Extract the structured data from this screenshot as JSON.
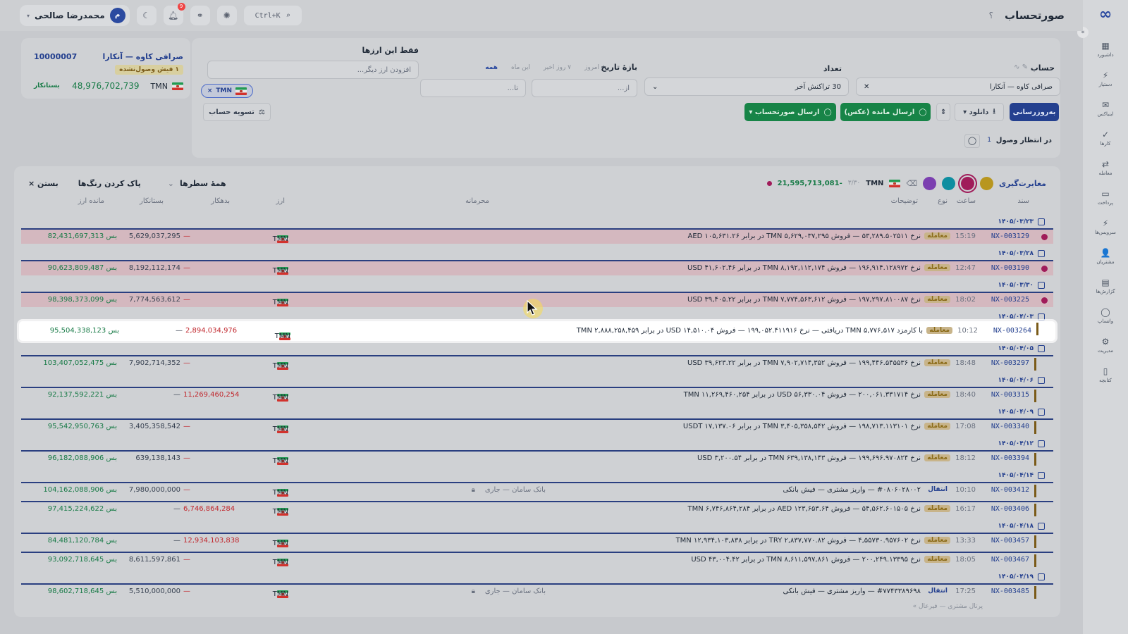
{
  "app": {
    "title": "صورتحساب",
    "help": "؟"
  },
  "topbar": {
    "search": "Ctrl+K",
    "notif_count": "9",
    "user_name": "محمدرضا صالحی",
    "user_initial": "م"
  },
  "sidebar": [
    {
      "icon": "dashboard-icon",
      "glyph": "▦",
      "label": "داشبورد"
    },
    {
      "icon": "assistant-icon",
      "glyph": "⚡",
      "label": "دستیار"
    },
    {
      "icon": "inbox-icon",
      "glyph": "✉",
      "label": "اینباکس"
    },
    {
      "icon": "tasks-icon",
      "glyph": "✓",
      "label": "کارها"
    },
    {
      "icon": "trade-icon",
      "glyph": "⇄",
      "label": "معامله"
    },
    {
      "icon": "payment-icon",
      "glyph": "▭",
      "label": "پرداخت"
    },
    {
      "icon": "services-icon",
      "glyph": "⚡",
      "label": "سرویس‌ها"
    },
    {
      "icon": "customers-icon",
      "glyph": "👤",
      "label": "مشتریان"
    },
    {
      "icon": "reports-icon",
      "glyph": "▤",
      "label": "گزارش‌ها"
    },
    {
      "icon": "whatsapp-icon",
      "glyph": "◯",
      "label": "واتساپ"
    },
    {
      "icon": "management-icon",
      "glyph": "⚙",
      "label": "مدیریت"
    },
    {
      "icon": "library-icon",
      "glyph": "▯",
      "label": "کتابچه"
    }
  ],
  "filters": {
    "account_label": "حساب",
    "account_value": "صرافی کاوه — آنکارا",
    "count_label": "تعداد",
    "count_value": "30 تراکنش آخر",
    "date_label": "بازهٔ تاریخ",
    "date_chips": [
      "امروز",
      "۷ روز اخیر",
      "این ماه",
      "همه"
    ],
    "from_placeholder": "از...",
    "to_placeholder": "تا...",
    "currency_label": "فقط این ارزها",
    "currency_placeholder": "افزودن ارز دیگر...",
    "currency_chip": "TMN",
    "btn_refresh": "به‌روزرسانی",
    "btn_download": "دانلود ▾",
    "btn_send_balance": "ارسال مانده (عکس)",
    "btn_send_statement": "ارسال صورتحساب ▾",
    "btn_settle": "تسویه حساب",
    "pending_label": "در انتظار وصول",
    "pending_count": "1"
  },
  "summary": {
    "name": "صرافی کاوه — آنکارا",
    "code": "10000007",
    "pending": "۱ فیش وصول‌نشده",
    "currency": "TMN",
    "balance": "48,976,702,739",
    "status": "بستانکار"
  },
  "table_toolbar": {
    "title": "مغایرت‌گیری",
    "colors": [
      "#b8961f",
      "#a01c5a",
      "#0e8ea0",
      "#7b3fb0"
    ],
    "currency": "TMN",
    "ratio": "۳/۳۰",
    "amount": "-21,595,713,081",
    "rows_filter": "همهٔ سطرها",
    "clear_colors": "پاک کردن رنگ‌ها",
    "close": "بستن ×"
  },
  "columns": {
    "doc": "سند",
    "time": "ساعت",
    "type": "نوع",
    "desc": "توضیحات",
    "conf": "محرمانه",
    "cur": "ارز",
    "debit": "بدهکار",
    "credit": "بستانکار",
    "balance": "مانده ارز"
  },
  "rows": [
    {
      "date": "۱۴۰۵/۰۳/۲۳",
      "dot": "#a01c5a",
      "doc": "NX-003129",
      "time": "15:19",
      "type": "معامله",
      "desc": "نرخ ۵۳,۲۸۹.۵۰۲۵۱۱ — فروش TMN ۵,۶۲۹,۰۳۷,۲۹۵ در برابر AED ۱۰۵,۶۳۱.۲۶",
      "conf": "",
      "cur": "TMN",
      "debit": "—",
      "credit": "5,629,037,295",
      "balance": "بس 82,431,697,313",
      "tint": true
    },
    {
      "date": "۱۴۰۵/۰۳/۲۸",
      "dot": "#a01c5a",
      "doc": "NX-003190",
      "time": "12:47",
      "type": "معامله",
      "desc": "نرخ ۱۹۶,۹۱۴.۱۲۸۹۷۲ — فروش TMN ۸,۱۹۲,۱۱۲,۱۷۴ در برابر USD ۴۱,۶۰۲.۴۶",
      "conf": "",
      "cur": "TMN",
      "debit": "—",
      "credit": "8,192,112,174",
      "balance": "بس 90,623,809,487",
      "tint": true
    },
    {
      "date": "۱۴۰۵/۰۳/۳۰",
      "dot": "#a01c5a",
      "doc": "NX-003225",
      "time": "18:02",
      "type": "معامله",
      "desc": "نرخ ۱۹۷,۲۹۷.۸۱۰۰۸۷ — فروش TMN ۷,۷۷۴,۵۶۳,۶۱۲ در برابر USD ۳۹,۴۰۵.۲۲",
      "conf": "",
      "cur": "TMN",
      "debit": "—",
      "credit": "7,774,563,612",
      "balance": "بس 98,398,373,099",
      "tint": true
    },
    {
      "date": "۱۴۰۵/۰۴/۰۳",
      "dot": "",
      "doc": "NX-003264",
      "time": "10:12",
      "type": "معامله",
      "desc": "با کارمزد TMN ۵,۷۷۶,۵۱۷ دریافتی — نرخ ۱۹۹,۰۵۲.۴۱۱۹۱۶ — فروش USD ۱۴,۵۱۰.۰۴ در برابر TMN ۲,۸۸۸,۲۵۸,۴۵۹",
      "conf": "",
      "cur": "TMN",
      "debit": "2,894,034,976",
      "credit": "—",
      "balance": "بس 95,504,338,123",
      "highlight": true
    },
    {
      "date": "۱۴۰۵/۰۴/۰۵",
      "dot": "",
      "doc": "NX-003297",
      "time": "18:48",
      "type": "معامله",
      "desc": "نرخ ۱۹۹,۴۴۶.۵۴۵۵۳۶ — فروش TMN ۷,۹۰۲,۷۱۴,۳۵۲ در برابر USD ۳۹,۶۲۳.۲۲",
      "conf": "",
      "cur": "TMN",
      "debit": "—",
      "credit": "7,902,714,352",
      "balance": "بس 103,407,052,475"
    },
    {
      "date": "۱۴۰۵/۰۴/۰۶",
      "dot": "",
      "doc": "NX-003315",
      "time": "18:40",
      "type": "معامله",
      "desc": "نرخ ۲۰۰,۰۶۱.۳۳۱۷۱۴ — فروش USD ۵۶,۳۳۰.۰۴ در برابر TMN ۱۱,۲۶۹,۴۶۰,۲۵۴",
      "conf": "",
      "cur": "TMN",
      "debit": "11,269,460,254",
      "credit": "—",
      "balance": "بس 92,137,592,221"
    },
    {
      "date": "۱۴۰۵/۰۴/۰۹",
      "dot": "",
      "doc": "NX-003340",
      "time": "17:08",
      "type": "معامله",
      "desc": "نرخ ۱۹۸,۷۱۳.۱۱۳۱۰۱ — فروش TMN ۳,۴۰۵,۳۵۸,۵۴۲ در برابر USDT ۱۷,۱۳۷.۰۶",
      "conf": "",
      "cur": "TMN",
      "debit": "—",
      "credit": "3,405,358,542",
      "balance": "بس 95,542,950,763"
    },
    {
      "date": "۱۴۰۵/۰۴/۱۲",
      "dot": "",
      "doc": "NX-003394",
      "time": "18:12",
      "type": "معامله",
      "desc": "نرخ ۱۹۹,۶۹۶.۹۷۰۸۲۴ — فروش TMN ۶۳۹,۱۳۸,۱۴۳ در برابر USD ۳,۲۰۰.۵۴",
      "conf": "",
      "cur": "TMN",
      "debit": "—",
      "credit": "639,138,143",
      "balance": "بس 96,182,088,906"
    },
    {
      "date": "۱۴۰۵/۰۴/۱۴",
      "dot": "",
      "doc": "NX-003412",
      "time": "10:10",
      "type": "انتقال",
      "desc": "#۰۸۰۶۰۲۸۰۰۲ — واریز مشتری — فیش بانکی",
      "conf": "بانک سامان — جاری",
      "cur": "TMN",
      "debit": "—",
      "credit": "7,980,000,000",
      "balance": "بس 104,162,088,906"
    },
    {
      "date": "",
      "dot": "",
      "doc": "NX-003406",
      "time": "16:17",
      "type": "معامله",
      "desc": "نرخ ۵۴,۵۶۲.۶۰۱۵۰۵ — فروش AED ۱۲۳,۶۵۳.۶۴ در برابر TMN ۶,۷۴۶,۸۶۴,۲۸۴",
      "conf": "",
      "cur": "TMN",
      "debit": "6,746,864,284",
      "credit": "—",
      "balance": "بس 97,415,224,622"
    },
    {
      "date": "۱۴۰۵/۰۴/۱۸",
      "dot": "",
      "doc": "NX-003457",
      "time": "13:33",
      "type": "معامله",
      "desc": "نرخ ۴,۵۵۷۳۰.۹۵۷۶۰۲ — فروش TRY ۲,۸۳۷,۷۷۰.۸۲ در برابر TMN ۱۲,۹۳۴,۱۰۳,۸۳۸",
      "conf": "",
      "cur": "TMN",
      "debit": "12,934,103,838",
      "credit": "—",
      "balance": "بس 84,481,120,784"
    },
    {
      "date": "",
      "dot": "",
      "doc": "NX-003467",
      "time": "18:05",
      "type": "معامله",
      "desc": "نرخ ۲۰۰,۲۴۹.۱۳۳۹۵ — فروش TMN ۸,۶۱۱,۵۹۷,۸۶۱ در برابر USD ۴۳,۰۰۴.۴۲",
      "conf": "",
      "cur": "TMN",
      "debit": "—",
      "credit": "8,611,597,861",
      "balance": "بس 93,092,718,645"
    },
    {
      "date": "۱۴۰۵/۰۴/۱۹",
      "dot": "",
      "doc": "NX-003485",
      "time": "17:25",
      "type": "انتقال",
      "desc": "#۷۷۴۳۳۸۹۶۹۸ — واریز مشتری — فیش بانکی",
      "conf": "بانک سامان — جاری",
      "cur": "TMN",
      "debit": "—",
      "credit": "5,510,000,000",
      "balance": "بس 98,602,718,645"
    }
  ],
  "footer_link": "پرتال مشتری — فیرعال »"
}
